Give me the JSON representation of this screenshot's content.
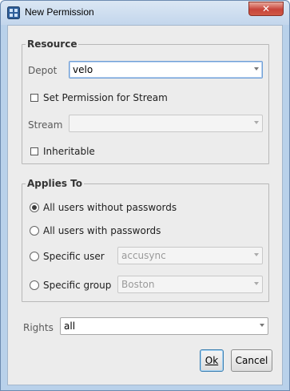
{
  "window": {
    "title": "New Permission",
    "close_glyph": "✕"
  },
  "resource": {
    "legend": "Resource",
    "depot_label": "Depot",
    "depot_value": "velo",
    "set_for_stream_label": "Set Permission for Stream",
    "stream_label": "Stream",
    "stream_value": "",
    "inheritable_label": "Inheritable"
  },
  "applies_to": {
    "legend": "Applies To",
    "options": [
      {
        "label": "All users without passwords",
        "checked": true
      },
      {
        "label": "All users with passwords",
        "checked": false
      },
      {
        "label": "Specific user",
        "checked": false
      },
      {
        "label": "Specific group",
        "checked": false
      }
    ],
    "user_value": "accusync",
    "group_value": "Boston"
  },
  "rights": {
    "label": "Rights",
    "value": "all"
  },
  "buttons": {
    "ok_label": "Ok",
    "cancel_label": "Cancel"
  },
  "icons": {
    "app": "permission-app-icon",
    "close": "close-icon",
    "dropdown": "chevron-down-icon"
  }
}
